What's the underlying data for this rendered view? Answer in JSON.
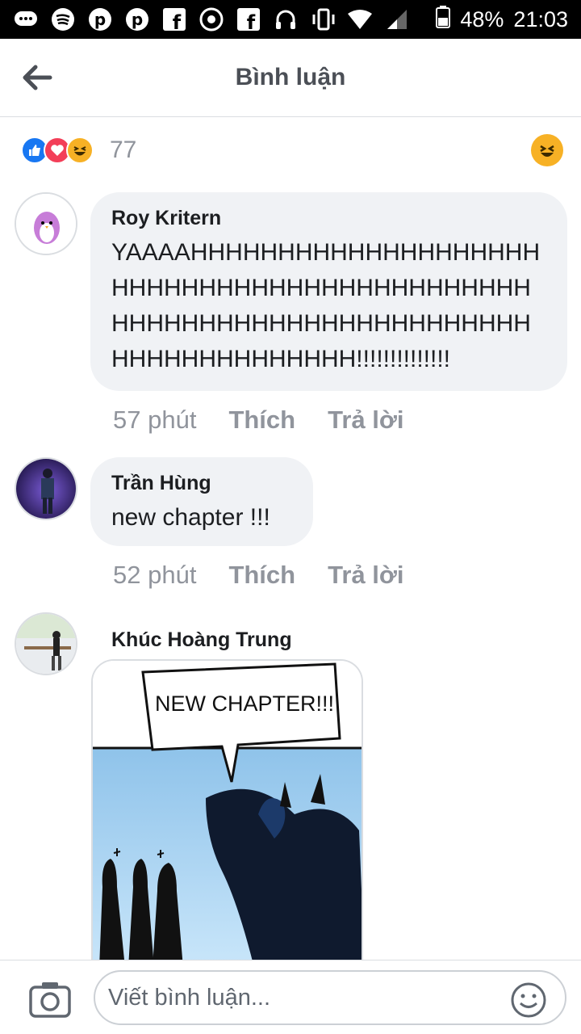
{
  "status_bar": {
    "battery": "48%",
    "time": "21:03"
  },
  "header": {
    "title": "Bình luận"
  },
  "reactions": {
    "count": "77"
  },
  "comments": [
    {
      "name": "Roy Kritern",
      "text": "YAAAAHHHHHHHHHHHHHHHHHHHHHHHHHHHHHHHHHHHHHHHHHHHHHHHHHHHHHHHHHHHHHHHHHHHHHHHHHHHHHHHHHH!!!!!!!!!!!!!!",
      "time": "57 phút",
      "like": "Thích",
      "reply": "Trả lời"
    },
    {
      "name": "Trần Hùng",
      "text": "new chapter !!!",
      "time": "52 phút",
      "like": "Thích",
      "reply": "Trả lời"
    },
    {
      "name": "Khúc Hoàng Trung",
      "image_text": "NEW CHAPTER!!!"
    }
  ],
  "composer": {
    "placeholder": "Viết bình luận..."
  },
  "colors": {
    "accent": "#1877f2",
    "bubble": "#f0f2f5",
    "meta": "#90949c"
  }
}
